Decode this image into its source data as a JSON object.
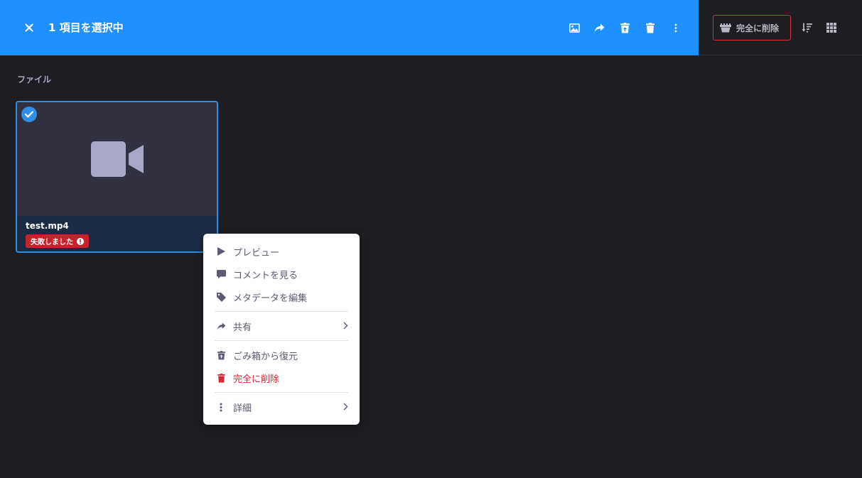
{
  "selection_bar": {
    "title": "1 項目を選択中",
    "bg_color": "#1e90ff",
    "actions": [
      {
        "icon": "image-icon",
        "label": "preview"
      },
      {
        "icon": "share-icon",
        "label": "share"
      },
      {
        "icon": "restore-trash-icon",
        "label": "restore"
      },
      {
        "icon": "trash-icon",
        "label": "delete"
      },
      {
        "icon": "more-vertical-icon",
        "label": "more"
      }
    ]
  },
  "right_toolbar": {
    "permanent_delete_label": "完全に削除",
    "danger_color": "#d9303a"
  },
  "section": {
    "label": "ファイル"
  },
  "file": {
    "name": "test.mp4",
    "status": "失敗しました",
    "selected": true,
    "status_color": "#c8232c",
    "accent_color": "#2f8fe8"
  },
  "context_menu": {
    "items": [
      {
        "label": "プレビュー",
        "icon": "play-icon"
      },
      {
        "label": "コメントを見る",
        "icon": "comment-icon"
      },
      {
        "label": "メタデータを編集",
        "icon": "tag-icon"
      },
      {
        "label": "共有",
        "icon": "share-icon"
      },
      {
        "label": "ごみ箱から復元",
        "icon": "restore-trash-icon"
      },
      {
        "label": "完全に削除",
        "icon": "trash-icon"
      },
      {
        "label": "詳細",
        "icon": "more-vertical-icon"
      }
    ]
  }
}
